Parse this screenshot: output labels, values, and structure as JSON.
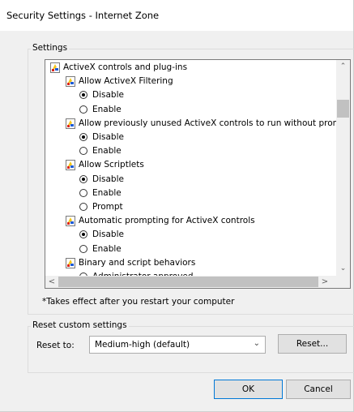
{
  "window": {
    "title": "Security Settings - Internet Zone"
  },
  "settings": {
    "group_label": "Settings",
    "items": [
      {
        "kind": "category",
        "text": "ActiveX controls and plug-ins"
      },
      {
        "kind": "setting",
        "text": "Allow ActiveX Filtering"
      },
      {
        "kind": "option",
        "text": "Disable",
        "checked": true
      },
      {
        "kind": "option",
        "text": "Enable",
        "checked": false
      },
      {
        "kind": "setting",
        "text": "Allow previously unused ActiveX controls to run without prom"
      },
      {
        "kind": "option",
        "text": "Disable",
        "checked": true
      },
      {
        "kind": "option",
        "text": "Enable",
        "checked": false
      },
      {
        "kind": "setting",
        "text": "Allow Scriptlets"
      },
      {
        "kind": "option",
        "text": "Disable",
        "checked": true
      },
      {
        "kind": "option",
        "text": "Enable",
        "checked": false
      },
      {
        "kind": "option",
        "text": "Prompt",
        "checked": false
      },
      {
        "kind": "setting",
        "text": "Automatic prompting for ActiveX controls"
      },
      {
        "kind": "option",
        "text": "Disable",
        "checked": true
      },
      {
        "kind": "option",
        "text": "Enable",
        "checked": false
      },
      {
        "kind": "setting",
        "text": "Binary and script behaviors"
      },
      {
        "kind": "option",
        "text": "Administrator approved",
        "checked": false
      }
    ],
    "note": "*Takes effect after you restart your computer"
  },
  "scrollbars": {
    "up": "⌃",
    "down": "⌄",
    "left": "<",
    "right": ">"
  },
  "reset": {
    "group_label": "Reset custom settings",
    "label": "Reset to:",
    "selected": "Medium-high (default)",
    "chevron": "⌄",
    "button": "Reset..."
  },
  "buttons": {
    "ok": "OK",
    "cancel": "Cancel"
  },
  "colors": {
    "accent": "#0078d7",
    "icon_yellow": "#f5c518",
    "icon_blue": "#1e5bd6",
    "icon_red": "#d9261c"
  }
}
